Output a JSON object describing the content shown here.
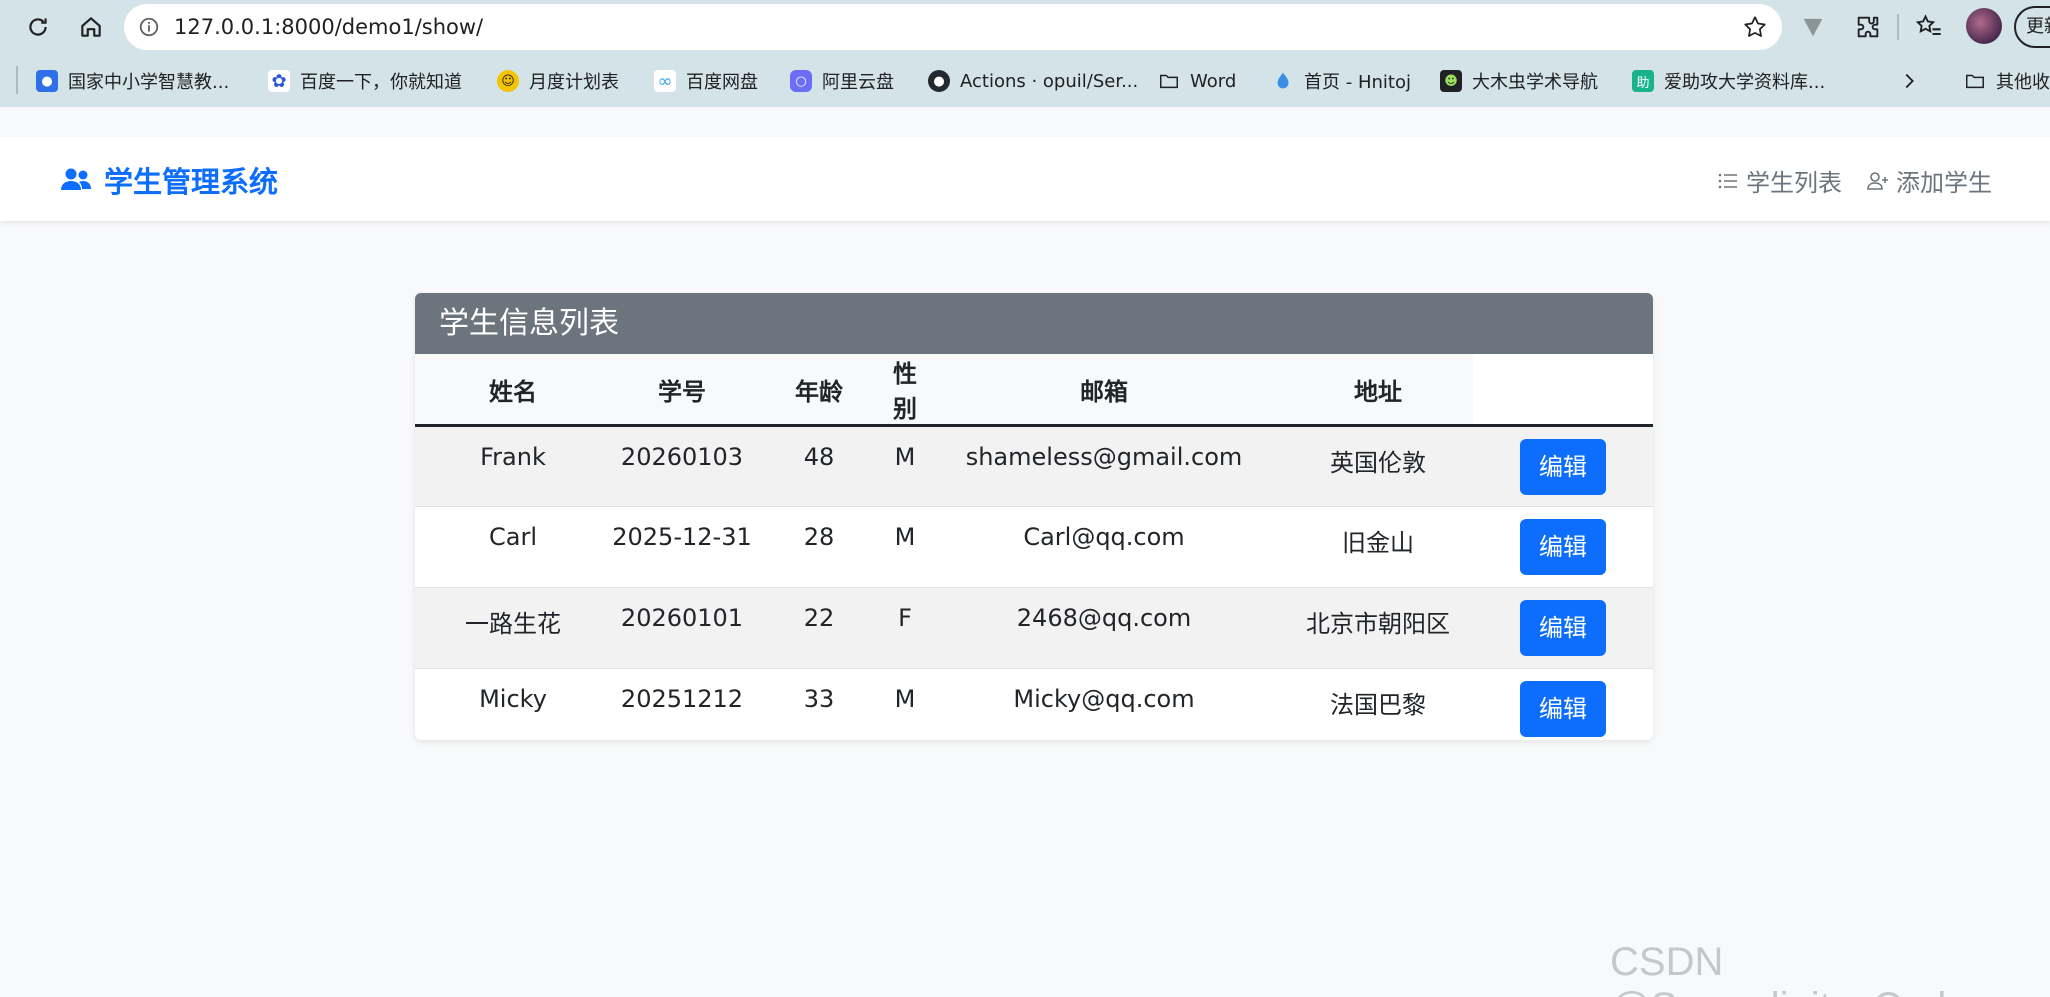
{
  "browser": {
    "url": "127.0.0.1:8000/demo1/show/",
    "update_label": "更新",
    "bookmarks": [
      {
        "label": "国家中小学智慧教...",
        "icon": "smart-edu-icon",
        "color": "#2f6fe8"
      },
      {
        "label": "百度一下，你就知道",
        "icon": "baidu-icon",
        "color": "#2d57d8"
      },
      {
        "label": "月度计划表",
        "icon": "smiley-icon",
        "color": "#f5c400"
      },
      {
        "label": "百度网盘",
        "icon": "baidu-netdisk-icon",
        "color": "#3aa3f2"
      },
      {
        "label": "阿里云盘",
        "icon": "aliyun-drive-icon",
        "color": "#6b6ef5"
      },
      {
        "label": "Actions · opuil/Ser...",
        "icon": "github-icon",
        "color": "#24292f"
      },
      {
        "label": "Word",
        "icon": "folder-icon",
        "color": "#202124"
      },
      {
        "label": "首页 - Hnitoj",
        "icon": "water-drop-icon",
        "color": "#3a8ee6"
      },
      {
        "label": "大木虫学术导航",
        "icon": "bug-icon",
        "color": "#3c8d1c"
      },
      {
        "label": "爱助攻大学资料库...",
        "icon": "help-icon",
        "color": "#18b38a"
      }
    ],
    "other_bookmarks": "其他收藏夹"
  },
  "navbar": {
    "brand": "学生管理系统",
    "links": [
      {
        "label": "学生列表",
        "icon": "list-icon"
      },
      {
        "label": "添加学生",
        "icon": "user-plus-icon"
      }
    ]
  },
  "card": {
    "title": "学生信息列表",
    "columns": [
      "姓名",
      "学号",
      "年龄",
      "性别",
      "邮箱",
      "地址",
      ""
    ],
    "rows": [
      {
        "name": "Frank",
        "id": "20260103",
        "age": "48",
        "gender": "M",
        "email": "shameless@gmail.com",
        "address": "英国伦敦",
        "action": "编辑"
      },
      {
        "name": "Carl",
        "id": "2025-12-31",
        "age": "28",
        "gender": "M",
        "email": "Carl@qq.com",
        "address": "旧金山",
        "action": "编辑"
      },
      {
        "name": "一路生花",
        "id": "20260101",
        "age": "22",
        "gender": "F",
        "email": "2468@qq.com",
        "address": "北京市朝阳区",
        "action": "编辑"
      },
      {
        "name": "Micky",
        "id": "20251212",
        "age": "33",
        "gender": "M",
        "email": "Micky@qq.com",
        "address": "法国巴黎",
        "action": "编辑"
      }
    ]
  },
  "watermark": "CSDN @Serendipity_Carl",
  "colors": {
    "primary": "#0d6efd",
    "header_bg": "#6c757d",
    "page_bg": "#f8f9fa"
  }
}
